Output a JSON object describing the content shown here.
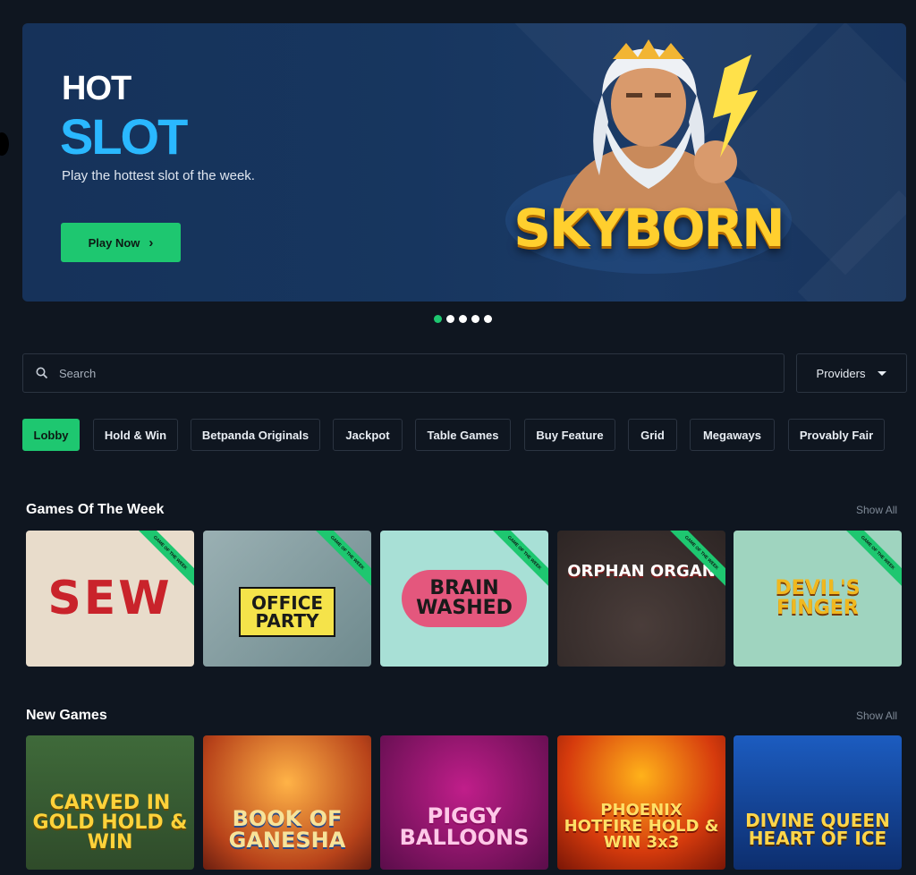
{
  "hero": {
    "kicker": "HOT",
    "title": "SLOT",
    "subtitle": "Play the hottest slot of the week.",
    "cta": "Play Now",
    "game_logo": "SKYBORN"
  },
  "carousel": {
    "count": 5,
    "active_index": 0
  },
  "search": {
    "placeholder": "Search"
  },
  "providers": {
    "label": "Providers"
  },
  "tabs": [
    "Lobby",
    "Hold & Win",
    "Betpanda Originals",
    "Jackpot",
    "Table Games",
    "Buy Feature",
    "Grid",
    "Megaways",
    "Provably Fair"
  ],
  "sections": {
    "week": {
      "title": "Games Of The Week",
      "show_all": "Show All",
      "ribbon": "GAME OF THE WEEK",
      "games": [
        "SEW",
        "OFFICE PARTY",
        "BRAIN WASHED",
        "ORPHAN ORGAN",
        "DEVIL'S FINGER"
      ]
    },
    "new": {
      "title": "New Games",
      "show_all": "Show All",
      "games": [
        "CARVED IN GOLD HOLD & WIN",
        "BOOK OF GANESHA",
        "PIGGY BALLOONS",
        "PHOENIX HOTFIRE HOLD & WIN 3x3",
        "DIVINE QUEEN HEART OF ICE"
      ]
    }
  },
  "colors": {
    "accent": "#1ec770",
    "background": "#0f1620",
    "slot_blue": "#2ab8ff"
  }
}
